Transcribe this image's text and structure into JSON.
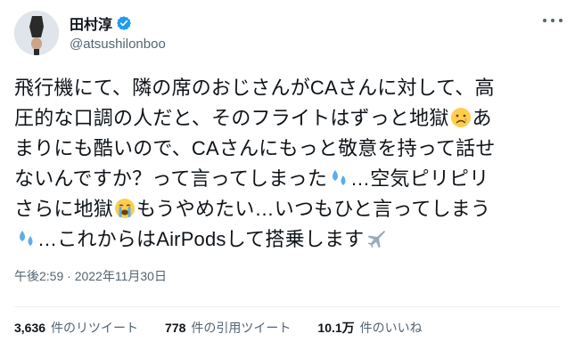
{
  "user": {
    "display_name": "田村淳",
    "handle": "@atsushilonboo"
  },
  "tweet": {
    "lines": [
      {
        "text": "飛行機にて、隣の席のおじさんがCAさんに対して、高",
        "emoji_after": ""
      },
      {
        "text": "圧的な口調の人だと、そのフライトはずっと地獄",
        "emoji_after": "sad-face",
        "tail": "あ"
      },
      {
        "text": "まりにも酷いので、CAさんにもっと敬意を持って話せ",
        "emoji_after": ""
      },
      {
        "text": "ないんですか？って言ってしまった",
        "emoji_after": "sweat-droplets",
        "tail": "…空気ピリピリ"
      },
      {
        "text": "さらに地獄",
        "emoji_after": "crying-face",
        "tail": "もうやめたい…いつもひと言ってしまう"
      },
      {
        "text": "",
        "emoji_after": "sweat-droplets",
        "tail": "…これからはAirPodsして搭乗します",
        "emoji_end": "airplane"
      }
    ],
    "timestamp": "午後2:59 · 2022年11月30日"
  },
  "stats": {
    "retweets_count": "3,636",
    "retweets_label": "件のリツイート",
    "quotes_count": "778",
    "quotes_label": "件の引用ツイート",
    "likes_count": "10.1万",
    "likes_label": "件のいいね"
  },
  "colors": {
    "verified": "#1d9bf0",
    "text": "#0f1419",
    "secondary": "#536471"
  }
}
